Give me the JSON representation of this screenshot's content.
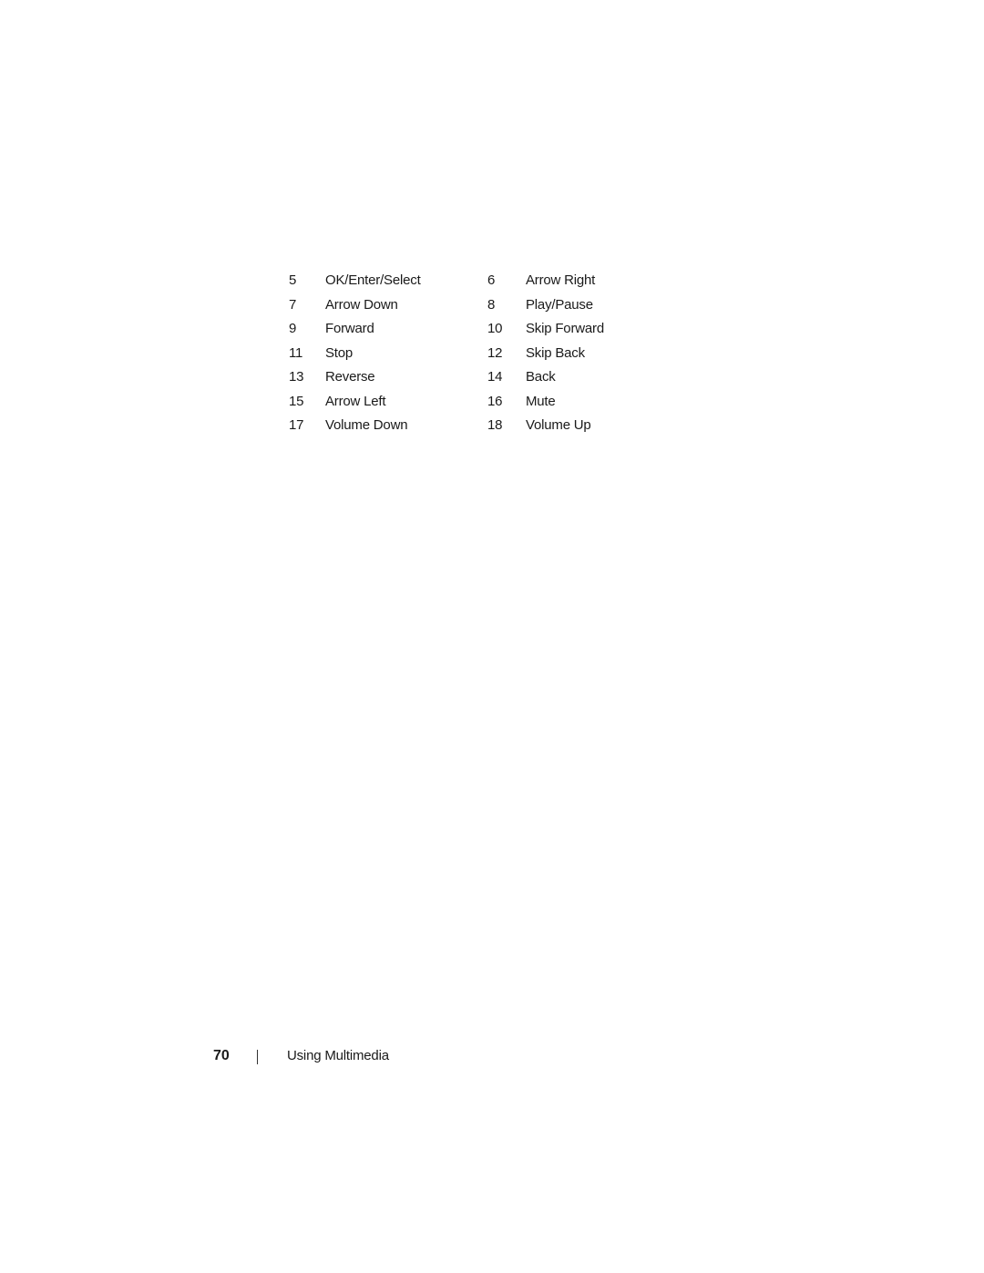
{
  "legend": {
    "rows": [
      {
        "left_num": "5",
        "left_label": "OK/Enter/Select",
        "right_num": "6",
        "right_label": "Arrow Right"
      },
      {
        "left_num": "7",
        "left_label": "Arrow Down",
        "right_num": "8",
        "right_label": "Play/Pause"
      },
      {
        "left_num": "9",
        "left_label": "Forward",
        "right_num": "10",
        "right_label": "Skip Forward"
      },
      {
        "left_num": "11",
        "left_label": "Stop",
        "right_num": "12",
        "right_label": "Skip Back"
      },
      {
        "left_num": "13",
        "left_label": "Reverse",
        "right_num": "14",
        "right_label": "Back"
      },
      {
        "left_num": "15",
        "left_label": "Arrow Left",
        "right_num": "16",
        "right_label": "Mute"
      },
      {
        "left_num": "17",
        "left_label": "Volume Down",
        "right_num": "18",
        "right_label": "Volume Up"
      }
    ]
  },
  "footer": {
    "page_number": "70",
    "separator": "|",
    "section_title": "Using Multimedia"
  }
}
